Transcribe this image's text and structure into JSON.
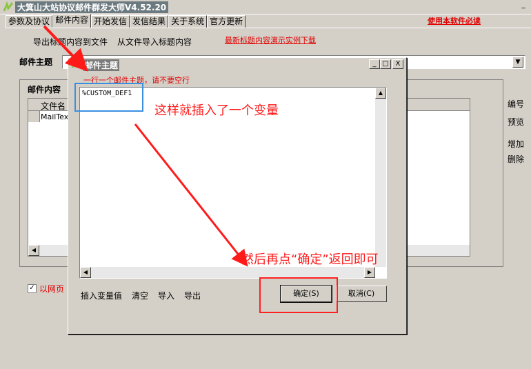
{
  "window": {
    "title": "大箕山大站协议邮件群发大师V4.52.20",
    "minimize": "_"
  },
  "tabs": [
    "参数及协议",
    "邮件内容",
    "开始发信",
    "发信结果",
    "关于系统",
    "官方更新"
  ],
  "must_read_link": "使用本软件必读",
  "toolbar": {
    "export_subjects": "导出标题内容到文件",
    "import_subjects": "从文件导入标题内容",
    "demo_link": "最新标题内容演示实例下载"
  },
  "subject": {
    "label": "邮件主题",
    "value": ""
  },
  "content_group": {
    "label": "邮件内容",
    "column_header": "文件名",
    "rows": [
      "MailText"
    ]
  },
  "side_buttons": [
    "编号",
    "预览",
    "增加",
    "删除"
  ],
  "web_checkbox": {
    "label": "以网页",
    "checked": true
  },
  "dialog": {
    "title": "邮件主题",
    "controls": [
      "_",
      "□",
      "X"
    ],
    "hint": "一行一个邮件主题，请不要空行",
    "text_value": "%CUSTOM_DEF1",
    "tools": [
      "插入变量值",
      "清空",
      "导入",
      "导出"
    ],
    "ok_label": "确定(S)",
    "cancel_label": "取消(C)"
  },
  "annotations": {
    "inserted_note": "这样就插入了一个变量",
    "then_note": "然后再点“确定”返回即可"
  },
  "colors": {
    "annotation_red": "#ff1a1a",
    "annotation_blue": "#3a8fe0",
    "link_red": "#e00000"
  }
}
